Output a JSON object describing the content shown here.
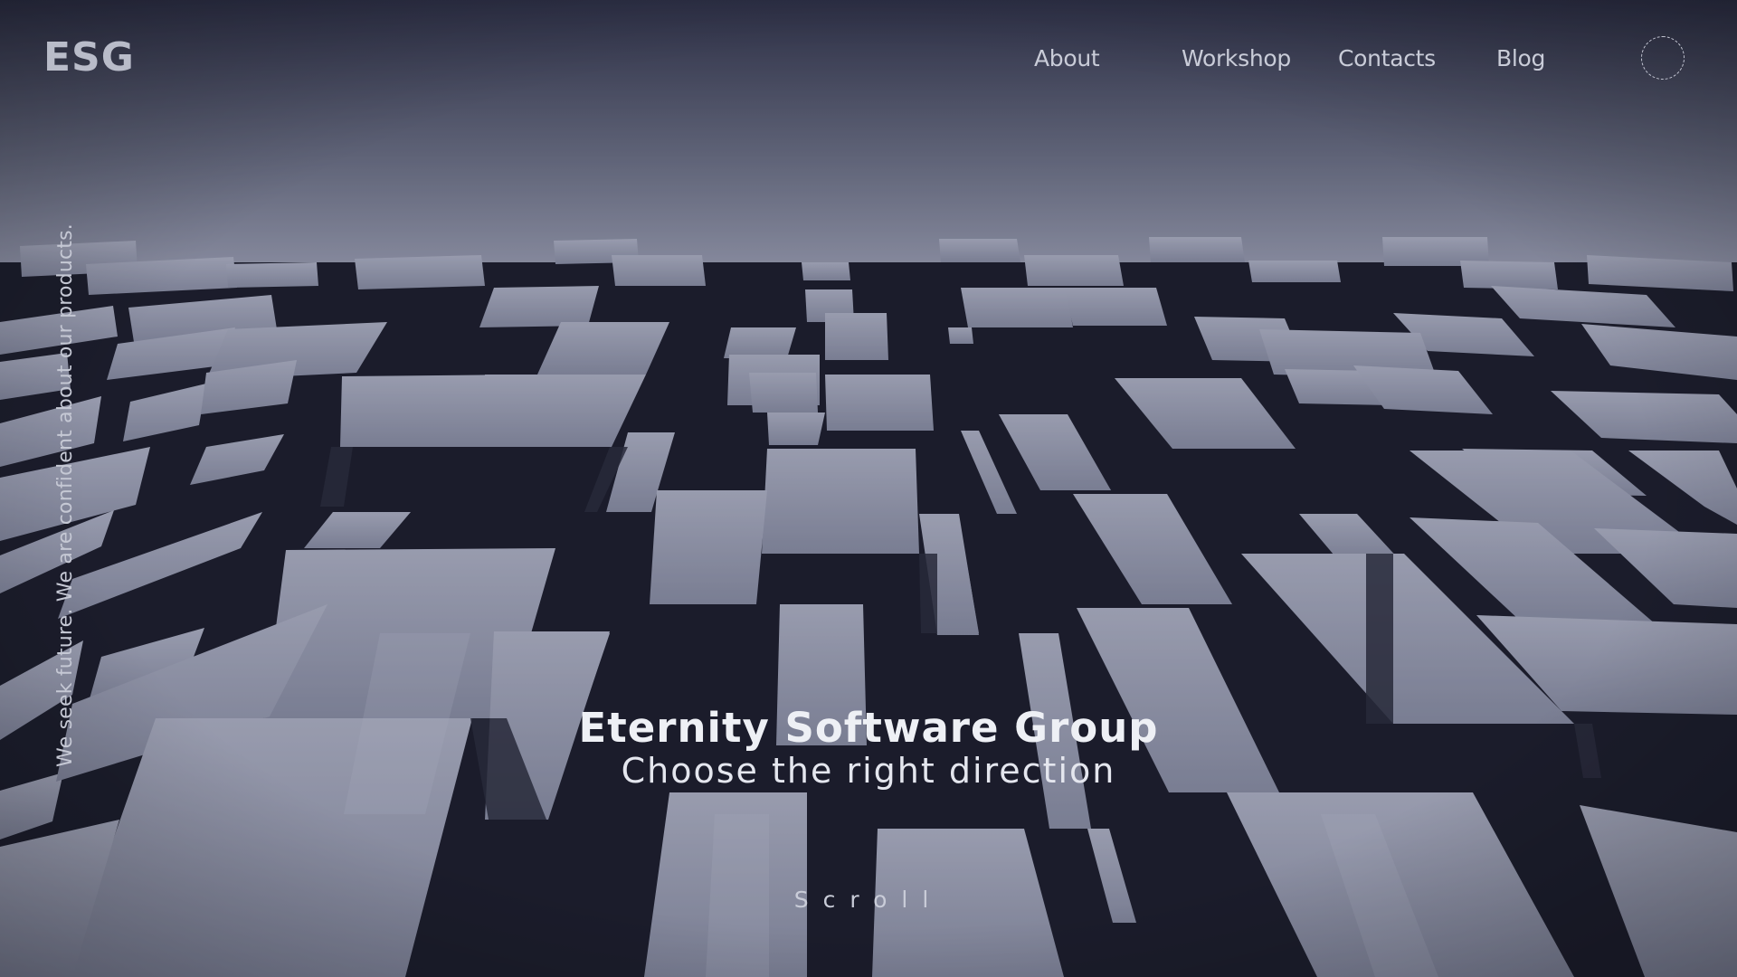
{
  "header": {
    "logo": "ESG",
    "nav": [
      {
        "label": "About"
      },
      {
        "label": "Workshop"
      },
      {
        "label": "Contacts"
      },
      {
        "label": "Blog"
      }
    ],
    "menu_icon": "dashed-circle-menu-icon"
  },
  "hero": {
    "background_image": "abstract-building-facade-blocks",
    "side_text": "We seek future. We are confident about our products.",
    "title": "Eternity Software Group",
    "subtitle": "Choose the right direction",
    "scroll_label": "Scroll"
  },
  "colors": {
    "background_dark": "#1a1c2a",
    "sky_top": "#343748",
    "sky_bottom": "#9a9fb4",
    "block_face": "#a4a8bd",
    "text_light": "#eef0f5"
  }
}
